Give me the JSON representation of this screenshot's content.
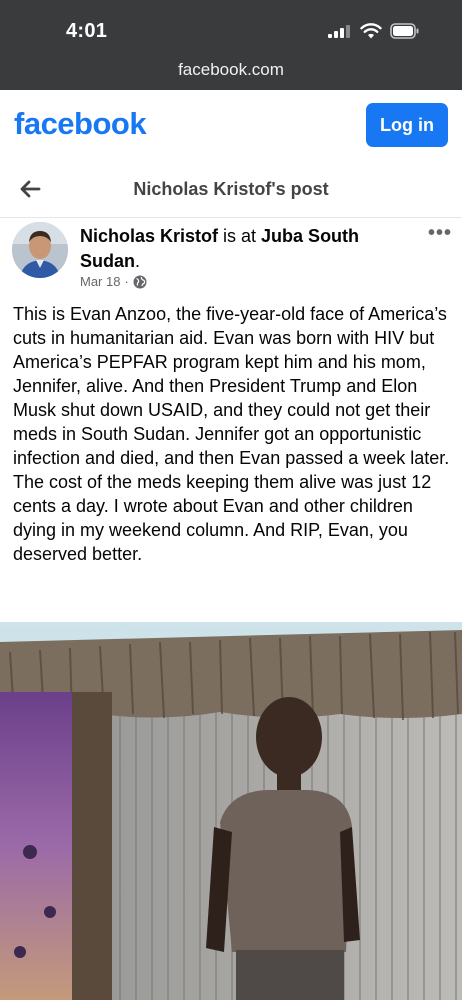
{
  "status_bar": {
    "time": "4:01",
    "url": "facebook.com",
    "icons": [
      "signal-icon",
      "wifi-icon",
      "battery-icon"
    ]
  },
  "header": {
    "logo": "facebook",
    "login_label": "Log in",
    "brand_color": "#1877f2"
  },
  "nav": {
    "back_icon": "back-arrow-icon",
    "title": "Nicholas Kristof's post"
  },
  "post": {
    "author": "Nicholas Kristof",
    "at_text": " is at ",
    "location": "Juba South Sudan",
    "location_suffix": ".",
    "date": "Mar 18",
    "separator": "·",
    "privacy_icon": "globe-icon",
    "more_icon": "more-options-icon",
    "more_label": "•••",
    "text": "This is Evan Anzoo, the five-year-old face of America’s cuts in humanitarian aid. Evan was born with HIV but America’s PEPFAR program kept him and his mom, Jennifer, alive. And then President Trump and Elon Musk shut down USAID, and they could not get their meds in South Sudan. Jennifer got an opportunistic infection and died, and then Evan passed a week later. The cost of the meds keeping them alive was just 12 cents a day. I wrote about Evan and other children dying in my weekend column. And RIP, Evan, you deserved better."
  }
}
